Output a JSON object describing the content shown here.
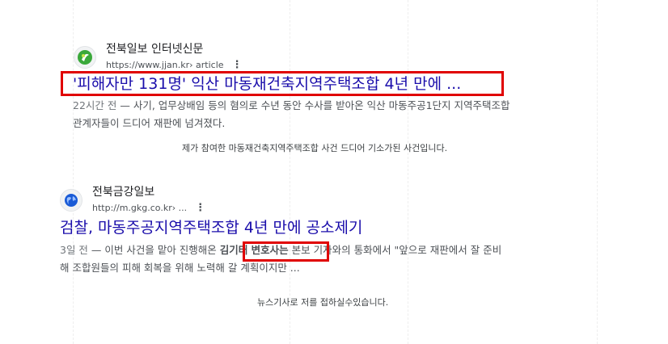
{
  "results": [
    {
      "source_name": "전북일보 인터넷신문",
      "url": "https://www.jjan.kr",
      "crumb": " › article",
      "title": "'피해자만 131명' 익산 마동재건축지역주택조합 4년 만에 ...",
      "date": "22시간 전",
      "dash": " — ",
      "snippet_line1": "사기, 업무상배임 등의 혐의로 수년 동안 수사를 받아온 익산 마동주공1단지 지역주택조합",
      "snippet_line2": "관계자들이 드디어 재판에 넘겨졌다.",
      "note": "제가 참여한 마동재건축지역주택조합 사건 드디어 기소가된 사건입니다.",
      "favicon_icon": "jjan-logo-icon",
      "accent": "#3aa83a"
    },
    {
      "source_name": "전북금강일보",
      "url": "http://m.gkg.co.kr",
      "crumb": " › ...",
      "title": "검찰, 마동주공지역주택조합 4년 만에 공소제기",
      "date": "3일 전",
      "dash": " — ",
      "snippet_pre": "이번 사건을 맡아 진행해온 ",
      "snippet_bold": "김기태 변호사는",
      "snippet_post": " 본보 기자와의 통화에서 \"앞으로 재판에서 잘 준비",
      "snippet_line2": "해 조합원들의 피해 회복을 위해 노력해 갈 계획이지만 ...",
      "note": "뉴스기사로 저를 접하실수있습니다.",
      "favicon_icon": "globe-icon",
      "accent": "#1a5bd6"
    }
  ],
  "highlight_color": "#e00000"
}
